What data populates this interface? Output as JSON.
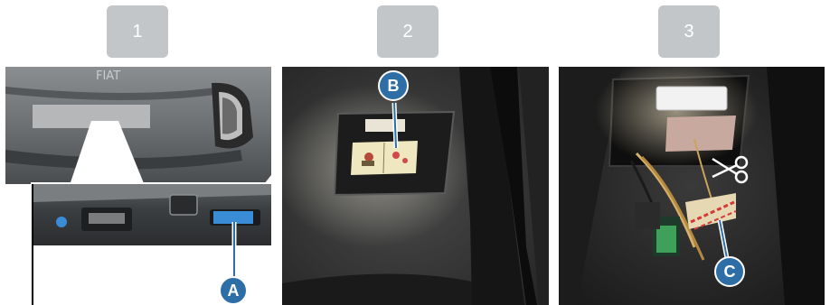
{
  "steps": [
    {
      "number": "1",
      "callout": "A"
    },
    {
      "number": "2",
      "callout": "B"
    },
    {
      "number": "3",
      "callout": "C"
    }
  ],
  "car": {
    "badge_text": "FIAT"
  },
  "colors": {
    "step_badge": "#c3c6c9",
    "callout_fill": "#2e6ea6",
    "highlight_blue": "#3a8cd6",
    "trunk_carpet": "#3a3a3a"
  },
  "icons": {
    "scissors": "scissors-icon"
  }
}
